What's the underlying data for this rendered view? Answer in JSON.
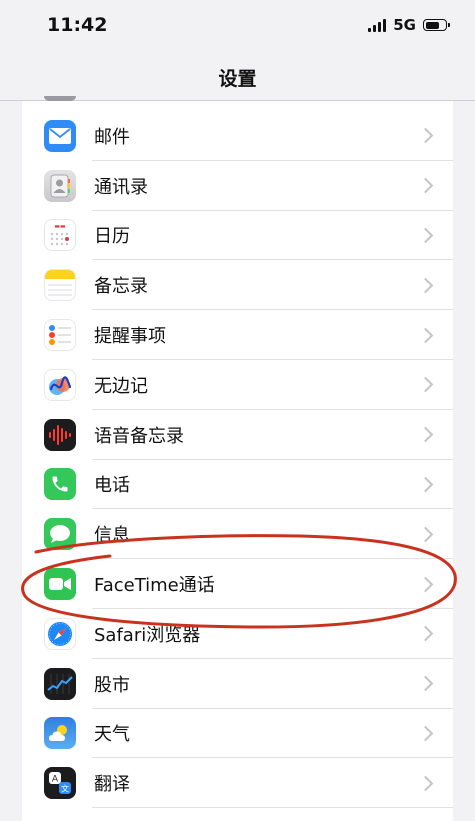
{
  "status_bar": {
    "time": "11:42",
    "network": "5G"
  },
  "nav": {
    "title": "设置"
  },
  "settings": {
    "items": [
      {
        "label": "邮件",
        "icon": "mail-icon"
      },
      {
        "label": "通讯录",
        "icon": "contacts-icon"
      },
      {
        "label": "日历",
        "icon": "calendar-icon"
      },
      {
        "label": "备忘录",
        "icon": "notes-icon"
      },
      {
        "label": "提醒事项",
        "icon": "reminders-icon"
      },
      {
        "label": "无边记",
        "icon": "freeform-icon"
      },
      {
        "label": "语音备忘录",
        "icon": "voice-memos-icon"
      },
      {
        "label": "电话",
        "icon": "phone-icon"
      },
      {
        "label": "信息",
        "icon": "messages-icon"
      },
      {
        "label": "FaceTime通话",
        "icon": "facetime-icon"
      },
      {
        "label": "Safari浏览器",
        "icon": "safari-icon"
      },
      {
        "label": "股市",
        "icon": "stocks-icon"
      },
      {
        "label": "天气",
        "icon": "weather-icon"
      },
      {
        "label": "翻译",
        "icon": "translate-icon"
      }
    ]
  },
  "colors": {
    "annotation": "#c8321e",
    "mail": "#2f8bf5",
    "phone": "#34c759",
    "facetime": "#30c553"
  }
}
